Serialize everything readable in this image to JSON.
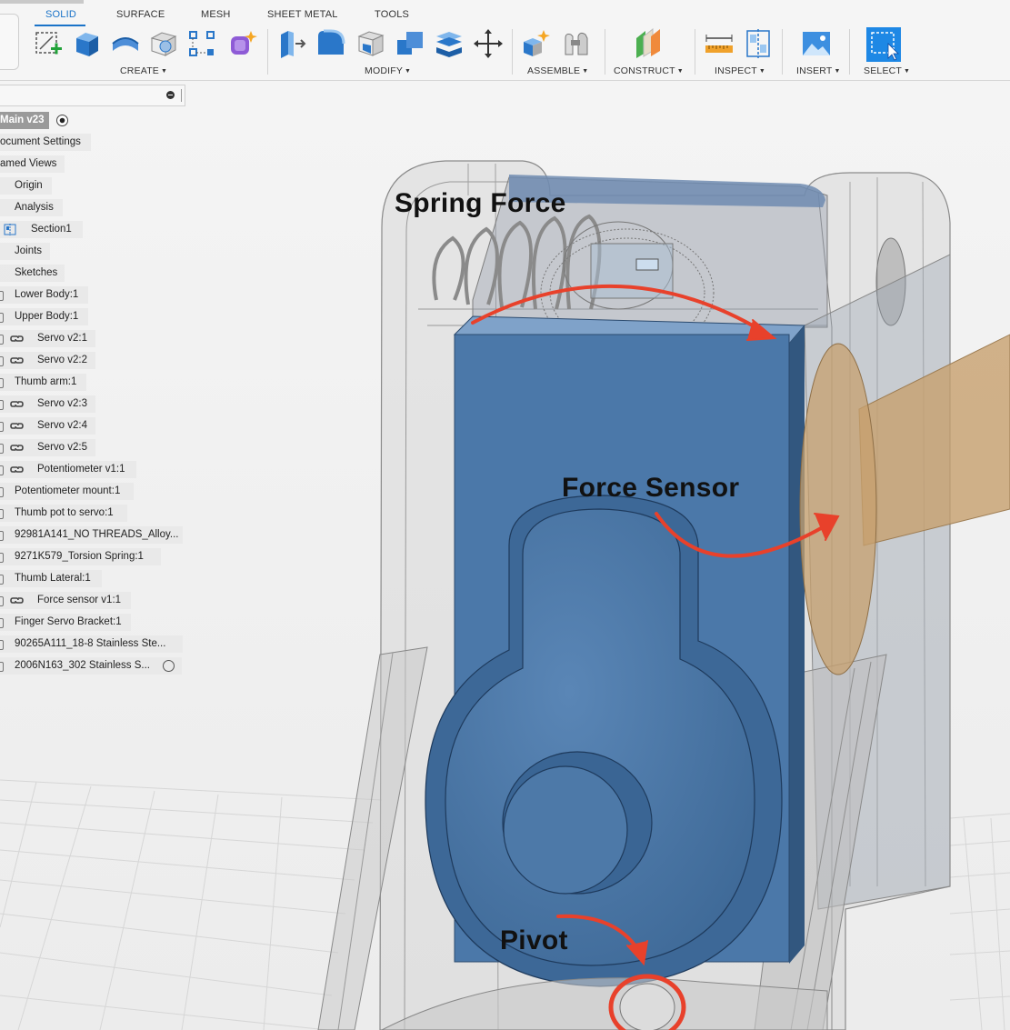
{
  "tabs": [
    {
      "label": "SOLID",
      "active": true
    },
    {
      "label": "SURFACE"
    },
    {
      "label": "MESH"
    },
    {
      "label": "SHEET METAL"
    },
    {
      "label": "TOOLS"
    }
  ],
  "groups": {
    "create": "CREATE",
    "modify": "MODIFY",
    "assemble": "ASSEMBLE",
    "construct": "CONSTRUCT",
    "inspect": "INSPECT",
    "insert": "INSERT",
    "select": "SELECT"
  },
  "browser": {
    "root": "Main v23",
    "items": [
      "ocument Settings",
      "amed Views",
      "Origin",
      "Analysis",
      "Section1",
      "Joints",
      "Sketches",
      "Lower Body:1",
      "Upper Body:1",
      "Servo v2:1",
      "Servo v2:2",
      "Thumb arm:1",
      "Servo v2:3",
      "Servo v2:4",
      "Servo v2:5",
      "Potentiometer v1:1",
      "Potentiometer mount:1",
      "Thumb pot to servo:1",
      "92981A141_NO THREADS_Alloy...",
      "9271K579_Torsion Spring:1",
      "Thumb Lateral:1",
      "Force sensor v1:1",
      "Finger Servo Bracket:1",
      "90265A111_18-8 Stainless Ste...",
      "2006N163_302 Stainless S..."
    ]
  },
  "annotations": {
    "spring": "Spring Force",
    "sensor": "Force Sensor",
    "pivot": "Pivot"
  },
  "colors": {
    "accent": "#1a73c8",
    "servo_blue": "#4d79a8",
    "arrow_red": "#e8412b",
    "sensor_tan": "#c7a06e"
  }
}
